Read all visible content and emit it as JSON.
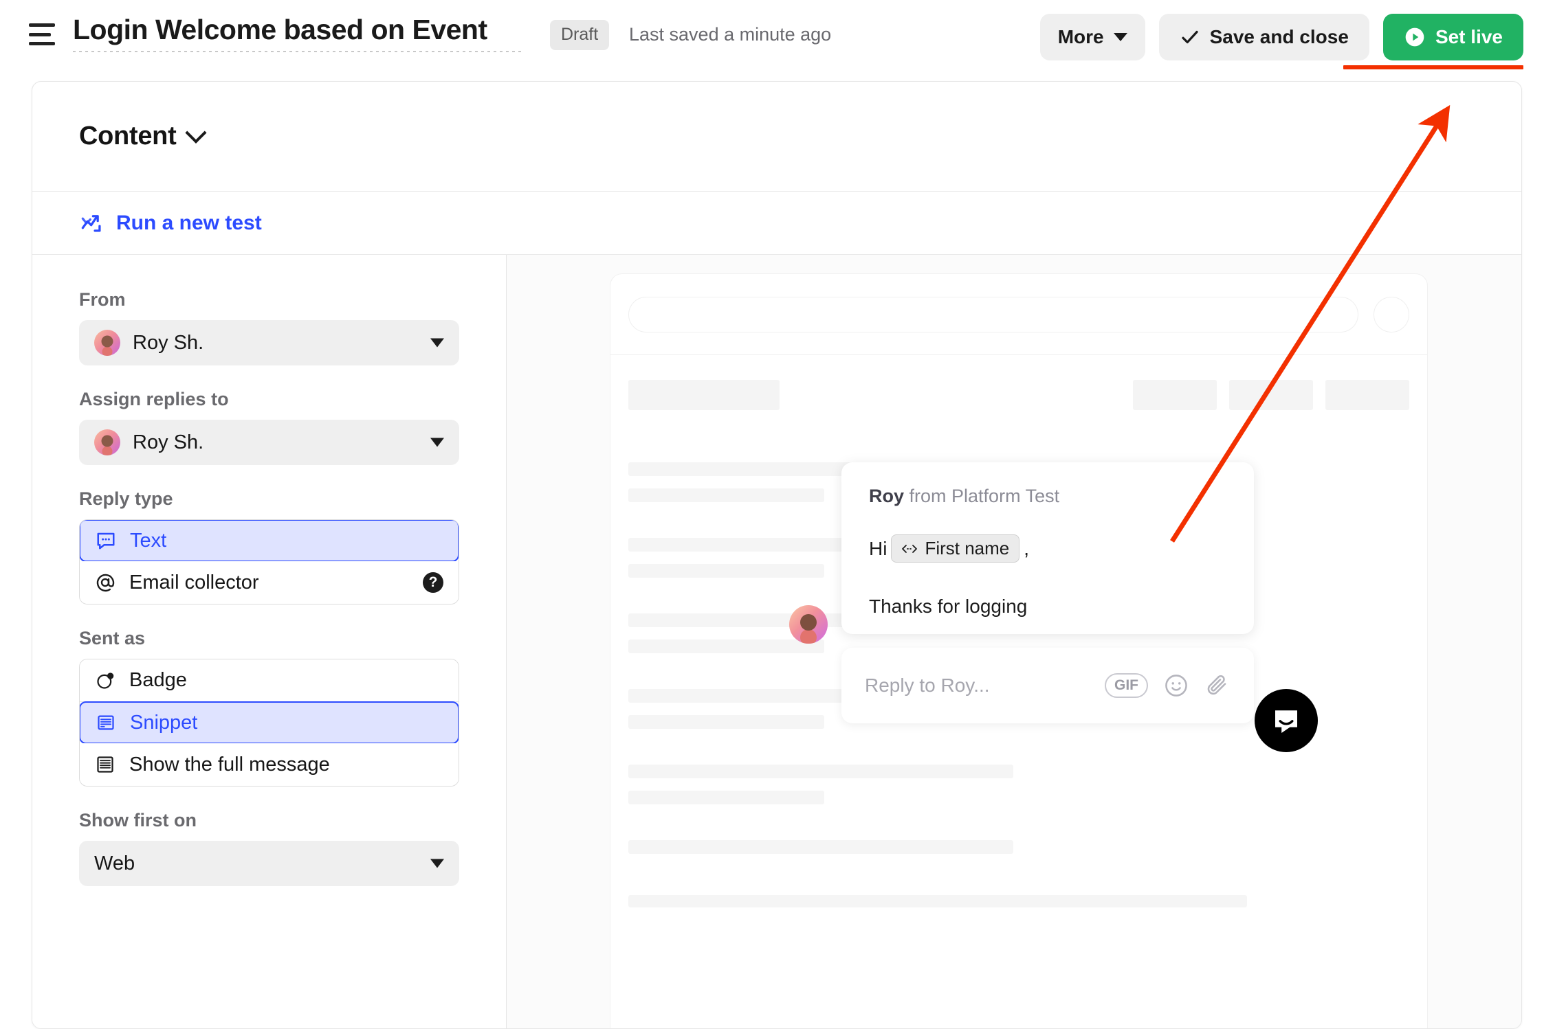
{
  "header": {
    "menu_icon": "hamburger-icon",
    "title": "Login Welcome based on Event",
    "status_badge": "Draft",
    "saved_text": "Last saved a minute ago",
    "buttons": {
      "more": "More",
      "save_and_close": "Save and close",
      "set_live": "Set live"
    },
    "accent_green": "#21b263",
    "annotation_red": "#f33000"
  },
  "card": {
    "section_title": "Content",
    "run_test_label": "Run a new test"
  },
  "sidebar": {
    "fields": [
      {
        "label": "From",
        "value": "Roy Sh.",
        "type": "select"
      },
      {
        "label": "Assign replies to",
        "value": "Roy Sh.",
        "type": "select"
      }
    ],
    "reply_type": {
      "label": "Reply type",
      "options": [
        {
          "label": "Text",
          "icon": "chat-bubble-icon",
          "selected": true
        },
        {
          "label": "Email collector",
          "icon": "at-sign-icon",
          "selected": false,
          "help": "?"
        }
      ]
    },
    "sent_as": {
      "label": "Sent as",
      "options": [
        {
          "label": "Badge",
          "icon": "badge-circle-icon",
          "selected": false
        },
        {
          "label": "Snippet",
          "icon": "snippet-icon",
          "selected": true
        },
        {
          "label": "Show the full message",
          "icon": "full-message-icon",
          "selected": false
        }
      ]
    },
    "show_first_on": {
      "label": "Show first on",
      "value": "Web",
      "type": "select"
    }
  },
  "preview": {
    "message": {
      "sender": "Roy",
      "from_suffix": "from Platform Test",
      "greeting": "Hi",
      "token": "First name",
      "token_icon": "merge-field-icon",
      "comma": ",",
      "body": "Thanks for logging"
    },
    "composer": {
      "placeholder": "Reply to Roy...",
      "gif_label": "GIF",
      "emoji_icon": "smiley-icon",
      "attach_icon": "paperclip-icon"
    },
    "launcher_icon": "intercom-messenger-icon"
  }
}
